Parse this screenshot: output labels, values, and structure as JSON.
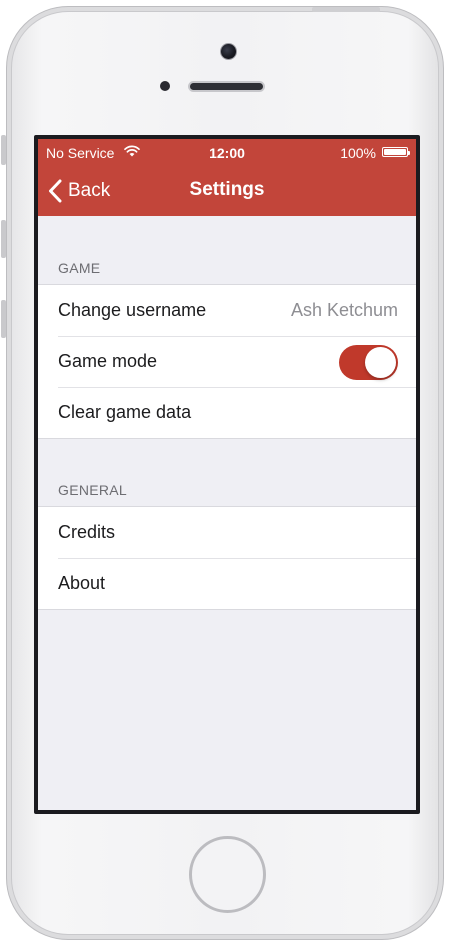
{
  "status_bar": {
    "carrier": "No Service",
    "time": "12:00",
    "battery": "100%",
    "wifi_icon": "wifi-icon",
    "battery_icon": "battery-icon"
  },
  "nav": {
    "back_label": "Back",
    "title": "Settings",
    "back_icon": "chevron-left-icon"
  },
  "sections": {
    "game": {
      "header": "GAME",
      "change_username_label": "Change username",
      "username_value": "Ash Ketchum",
      "game_mode_label": "Game mode",
      "game_mode_on": true,
      "clear_data_label": "Clear game data"
    },
    "general": {
      "header": "GENERAL",
      "credits_label": "Credits",
      "about_label": "About"
    }
  },
  "colors": {
    "accent": "#c2453a",
    "toggle_on": "#c0392b",
    "background": "#efeff4"
  }
}
